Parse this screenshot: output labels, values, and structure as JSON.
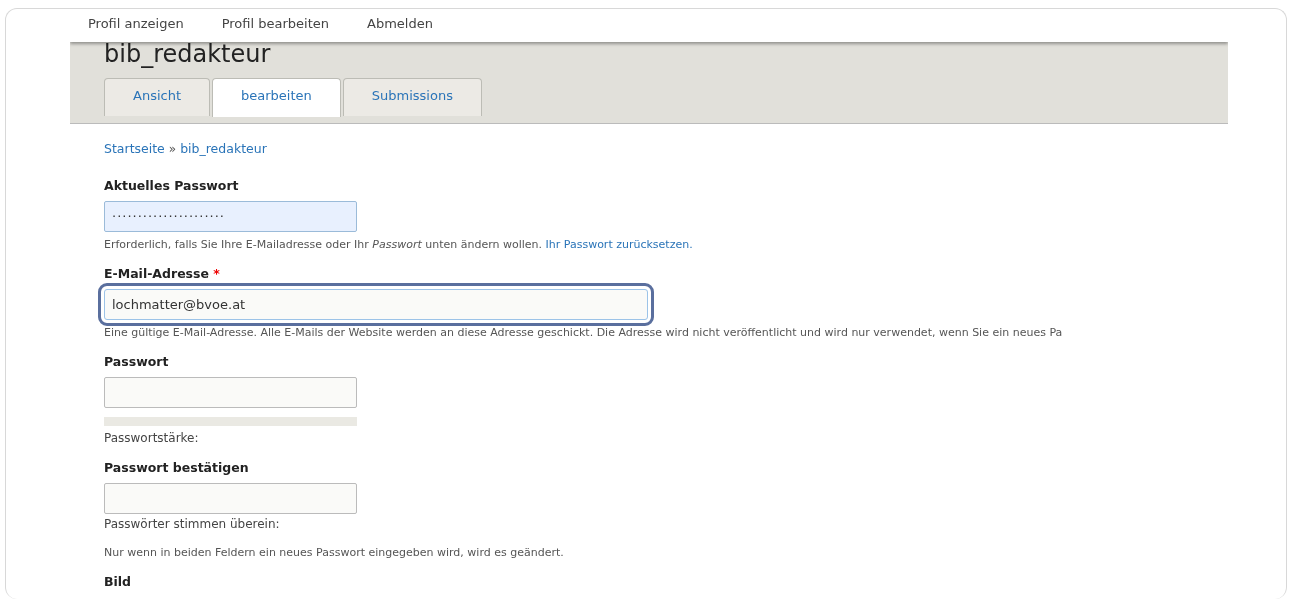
{
  "top_links": [
    {
      "label": "Profil anzeigen"
    },
    {
      "label": "Profil bearbeiten"
    },
    {
      "label": "Abmelden"
    }
  ],
  "page_title": "bib_redakteur",
  "required_mark": "*",
  "tabs": [
    {
      "label": "Ansicht",
      "selected": false
    },
    {
      "label": "bearbeiten",
      "selected": true
    },
    {
      "label": "Submissions",
      "selected": false
    }
  ],
  "breadcrumb": {
    "items": [
      "Startseite",
      "bib_redakteur"
    ],
    "separator": "»"
  },
  "fields": [
    {
      "kind": "password",
      "label": "Aktuelles Passwort",
      "required": false,
      "autofilled": true,
      "focused": false,
      "value": "······················",
      "description": "Erforderlich, falls Sie Ihre E-Mailadresse oder Ihr *Passwort* unten ändern wollen.",
      "description_link": "Ihr Passwort zurücksetzen."
    },
    {
      "kind": "email",
      "label": "E-Mail-Adresse",
      "required": true,
      "autofilled": false,
      "focused": true,
      "value": "lochmatter@bvoe.at",
      "description": "Eine gültige E-Mail-Adresse. Alle E-Mails der Website werden an diese Adresse geschickt. Die Adresse wird nicht veröffentlicht und wird nur verwendet, wenn Sie ein neues Pa"
    },
    {
      "kind": "password",
      "label": "Passwort",
      "required": false,
      "autofilled": false,
      "focused": false,
      "meter": {
        "level": 0,
        "caption": "Passwortstärke:"
      }
    },
    {
      "kind": "password",
      "label": "Passwort bestätigen",
      "required": false,
      "autofilled": false,
      "focused": false,
      "status": "Passwörter stimmen überein:"
    },
    {
      "kind": "note",
      "text": "Nur wenn in beiden Feldern ein neues Passwort eingegeben wird, wird es geändert."
    },
    {
      "kind": "heading",
      "label": "Bild"
    }
  ]
}
